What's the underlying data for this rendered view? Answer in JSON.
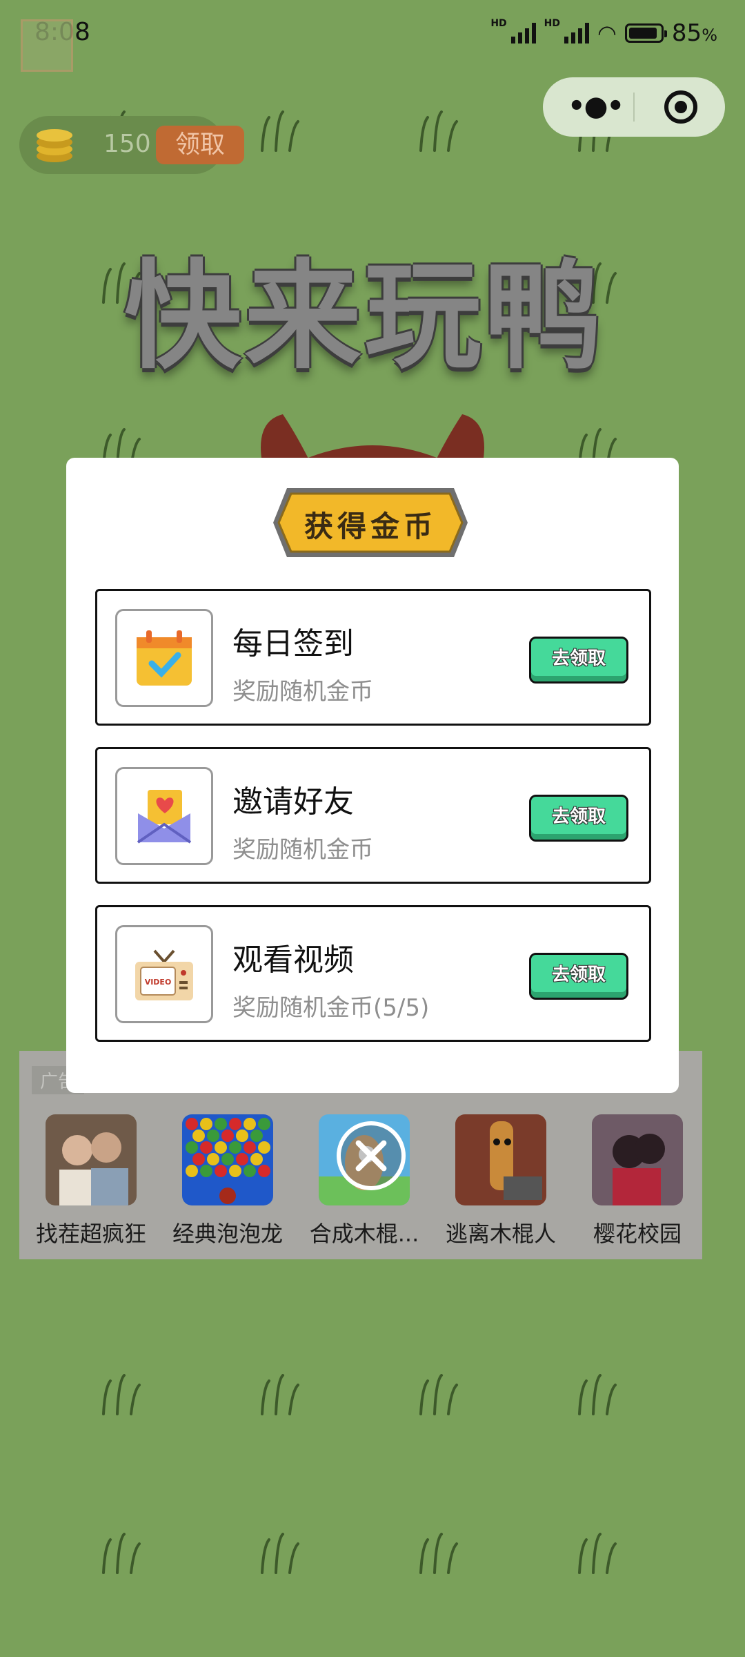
{
  "status_bar": {
    "time": "8:08",
    "battery_percent": "85",
    "battery_unit": "%",
    "network_label": "HD",
    "overflow": "···"
  },
  "capsule": {
    "more_icon": "more-dots-icon",
    "close_icon": "target-close-icon"
  },
  "coin_bar": {
    "count": "150",
    "claim_label": "领取"
  },
  "game_title": "快来玩鸭",
  "modal": {
    "header": "获得金币",
    "tasks": [
      {
        "title": "每日签到",
        "subtitle": "奖励随机金币",
        "button": "去领取",
        "icon": "calendar-check-icon"
      },
      {
        "title": "邀请好友",
        "subtitle": "奖励随机金币",
        "button": "去领取",
        "icon": "heart-envelope-icon"
      },
      {
        "title": "观看视频",
        "subtitle": "奖励随机金币(5/5)",
        "button": "去领取",
        "icon": "tv-video-icon"
      }
    ]
  },
  "ad_bar": {
    "tag": "广告",
    "items": [
      {
        "name": "找茬超疯狂"
      },
      {
        "name": "经典泡泡龙"
      },
      {
        "name": "合成木棍..."
      },
      {
        "name": "逃离木棍人"
      },
      {
        "name": "樱花校园"
      }
    ]
  },
  "colors": {
    "background": "#7aa15a",
    "claim_button": "#45d99a",
    "banner": "#f2b829"
  }
}
